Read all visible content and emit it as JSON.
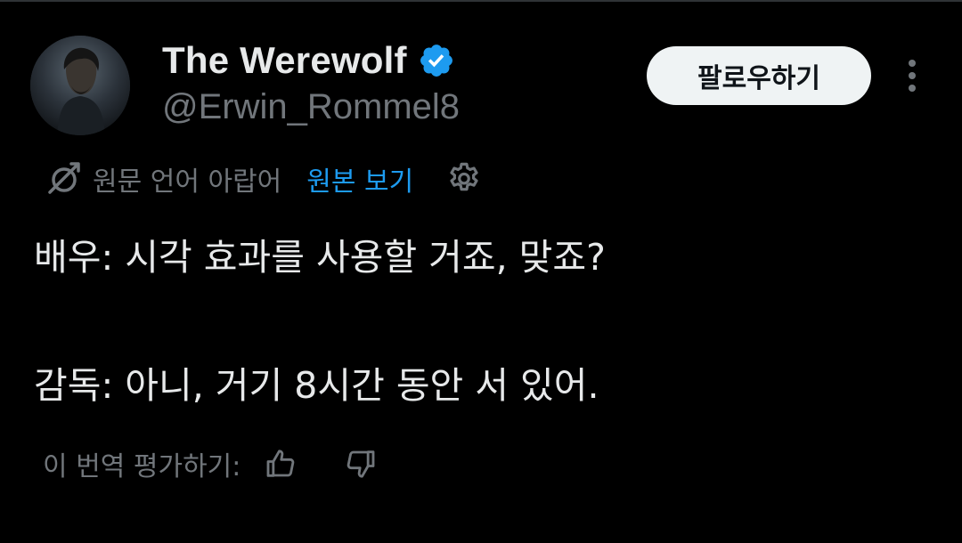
{
  "author": {
    "display_name": "The Werewolf",
    "handle": "@Erwin_Rommel8",
    "verified": true
  },
  "actions": {
    "follow_label": "팔로우하기"
  },
  "translation": {
    "note": "원문 언어 아랍어",
    "view_original_label": "원본 보기"
  },
  "tweet": {
    "lines": [
      "배우: 시각 효과를 사용할 거죠, 맞죠?",
      "감독: 아니, 거기 8시간 동안 서 있어."
    ]
  },
  "rating": {
    "label": "이 번역 평가하기:"
  },
  "colors": {
    "background": "#000000",
    "text_primary": "#e7e9ea",
    "text_secondary": "#71767b",
    "accent": "#1d9bf0",
    "follow_button_bg": "#eff3f4"
  },
  "icons": {
    "verified": "verified-badge-icon",
    "more": "more-dots-icon",
    "translate": "translate-icon",
    "settings": "gear-icon",
    "thumbs_up": "thumbs-up-icon",
    "thumbs_down": "thumbs-down-icon"
  }
}
